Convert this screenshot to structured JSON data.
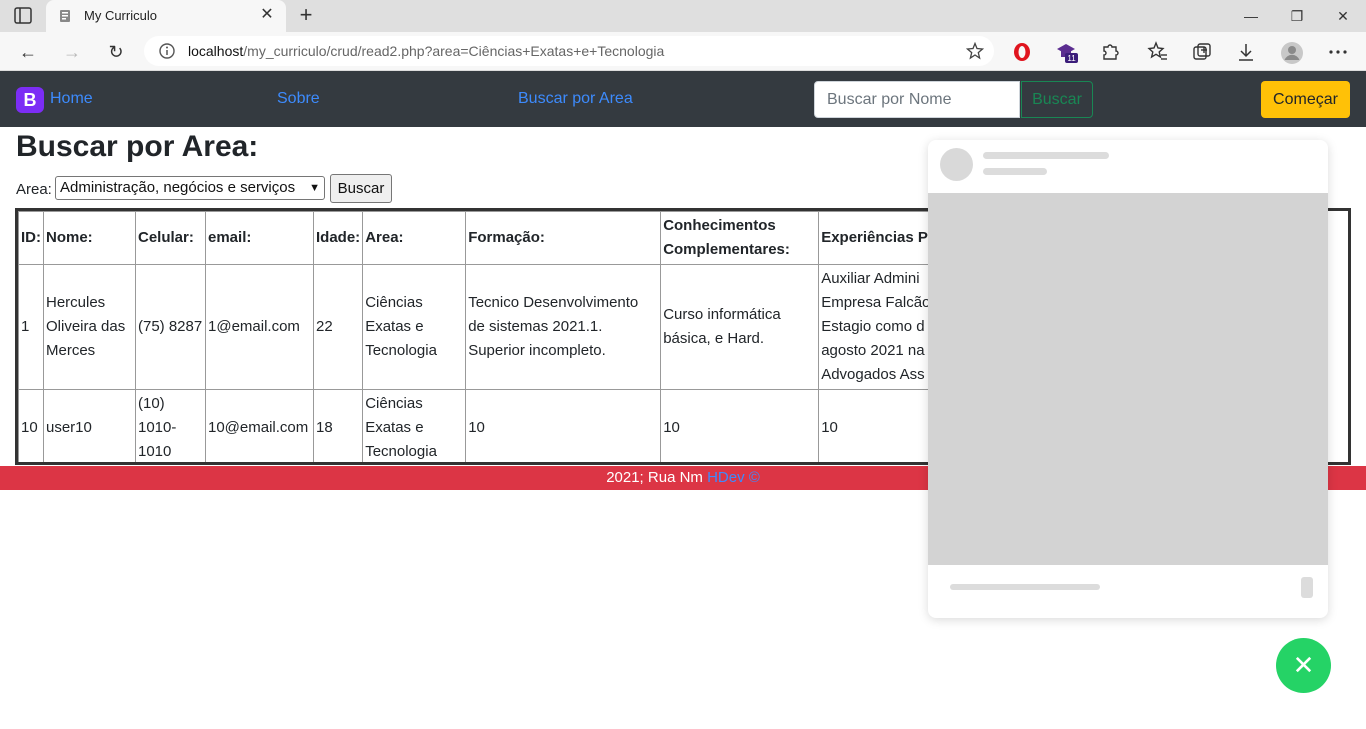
{
  "browser": {
    "tab_title": "My Curriculo",
    "url_host": "localhost",
    "url_path": "/my_curriculo/crud/read2.php?area=Ciências+Exatas+e+Tecnologia",
    "ext_badge": "11"
  },
  "navbar": {
    "brand_letter": "B",
    "home": "Home",
    "about": "Sobre",
    "search_area": "Buscar por Area",
    "search_placeholder": "Buscar por Nome",
    "search_button": "Buscar",
    "start_button": "Começar"
  },
  "main": {
    "title": "Buscar por Area:",
    "area_label": "Area:",
    "area_selected": "Administração, negócios e serviços",
    "area_button": "Buscar"
  },
  "table": {
    "headers": [
      "ID:",
      "Nome:",
      "Celular:",
      "email:",
      "Idade:",
      "Area:",
      "Formação:",
      "Conhecimentos Complementares:",
      "Experiências P"
    ],
    "rows": [
      {
        "id": "1",
        "nome": "Hercules Oliveira das Merces",
        "celular": "(75) 8287",
        "email": "1@email.com",
        "idade": "22",
        "area": "Ciências Exatas e Tecnologia",
        "formacao": "Tecnico Desenvolvimento de sistemas 2021.1. Superior incompleto.",
        "conhecimentos": "Curso informática básica, e Hard.",
        "experiencias": "Auxiliar Admini Empresa Falcão Estagio como d agosto 2021 na Advogados Ass"
      },
      {
        "id": "10",
        "nome": "user10",
        "celular": "(10) 1010-1010",
        "email": "10@email.com",
        "idade": "18",
        "area": "Ciências Exatas e Tecnologia",
        "formacao": "10",
        "conhecimentos": "10",
        "experiencias": "10"
      }
    ]
  },
  "footer": {
    "text": "2021; Rua Nm ",
    "link": "HDev ©"
  },
  "colors": {
    "navbar_bg": "#343a40",
    "footer_bg": "#dc3545",
    "start_btn": "#ffc107",
    "search_btn": "#198754",
    "fab": "#25d366"
  }
}
